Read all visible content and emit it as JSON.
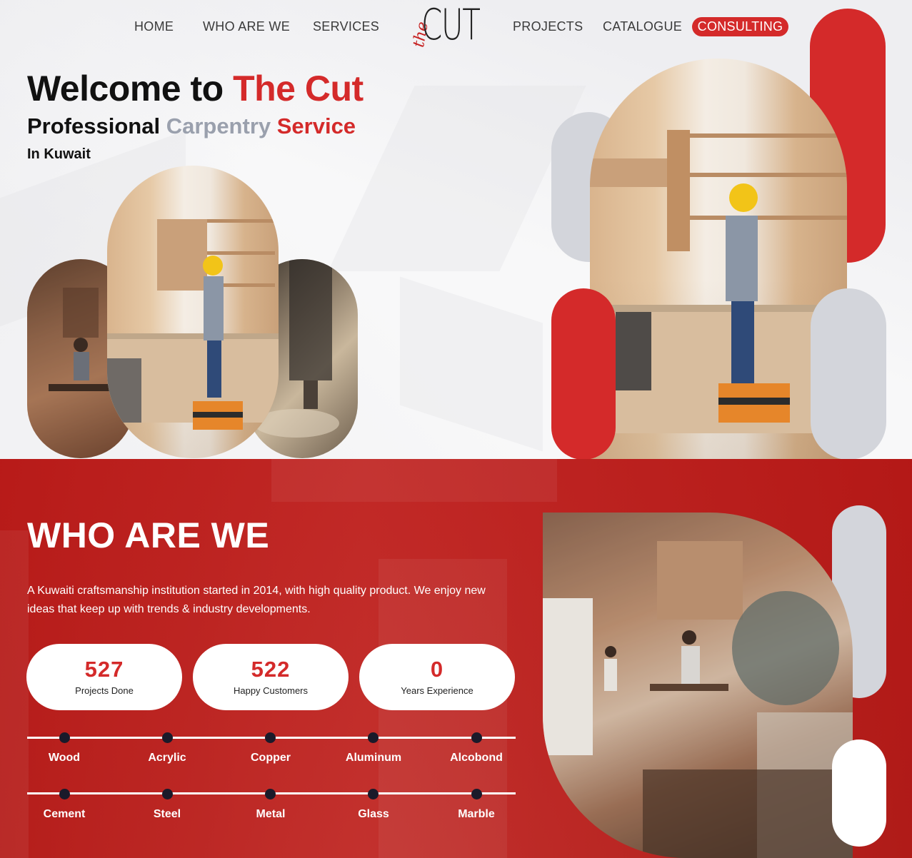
{
  "nav": {
    "links": [
      "HOME",
      "WHO ARE WE",
      "SERVICES",
      "PROJECTS",
      "CATALOGUE"
    ],
    "cta": "CONSULTING",
    "logo_script": "the",
    "logo_main": "CUT"
  },
  "hero": {
    "title_prefix": "Welcome to ",
    "title_accent": "The Cut",
    "sub_1": "Professional ",
    "sub_2": "Carpentry ",
    "sub_3": "Service",
    "location": "In Kuwait"
  },
  "about": {
    "title": "WHO ARE WE",
    "text": "A Kuwaiti craftsmanship institution started in 2014, with high quality product. We enjoy new ideas that keep up with trends & industry developments.",
    "stats": [
      {
        "value": "527",
        "label": "Projects Done"
      },
      {
        "value": "522",
        "label": "Happy Customers"
      },
      {
        "value": "0",
        "label": "Years Experience"
      }
    ],
    "materials_row1": [
      "Wood",
      "Acrylic",
      "Copper",
      "Aluminum",
      "Alcobond"
    ],
    "materials_row2": [
      "Cement",
      "Steel",
      "Metal",
      "Glass",
      "Marble"
    ]
  },
  "colors": {
    "accent": "#d42a2a",
    "grey_accent": "#9aa0ad",
    "dark_dot": "#1a1a2a"
  }
}
